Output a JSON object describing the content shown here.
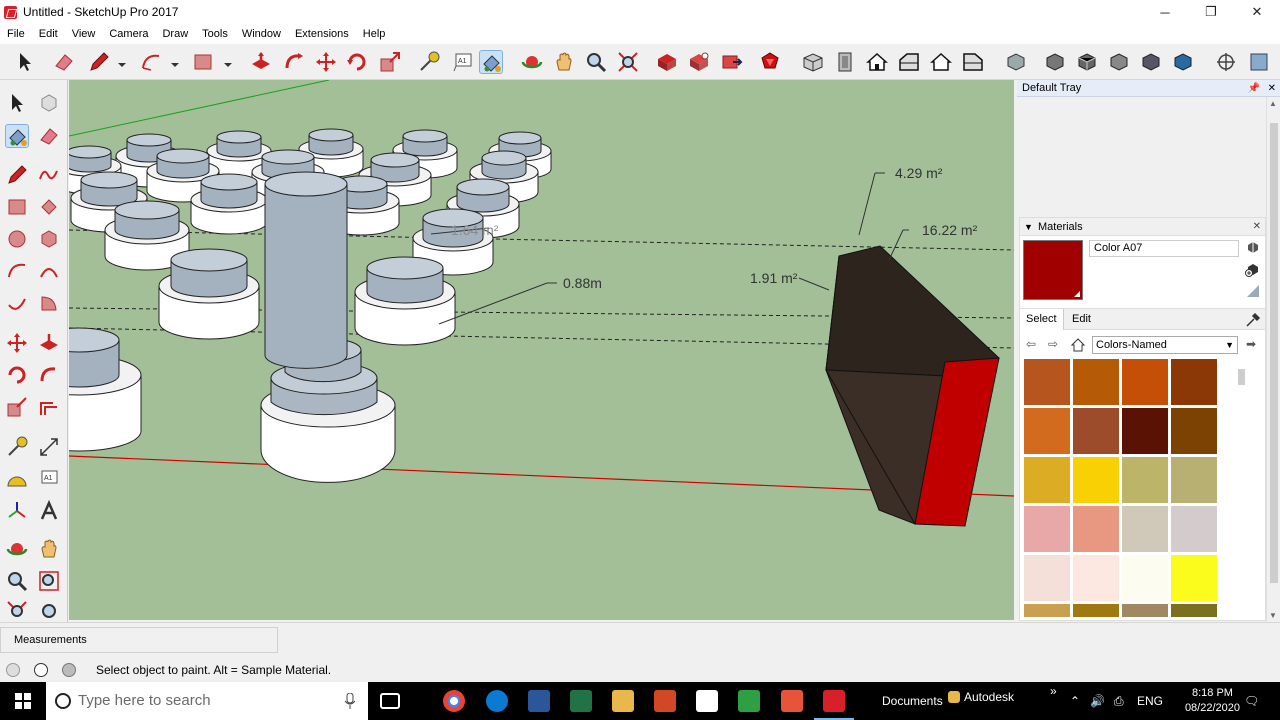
{
  "window": {
    "title": "Untitled - SketchUp Pro 2017",
    "controls": {
      "minimize": "─",
      "maximize": "❐",
      "close": "✕"
    }
  },
  "menu": [
    "File",
    "Edit",
    "View",
    "Camera",
    "Draw",
    "Tools",
    "Window",
    "Extensions",
    "Help"
  ],
  "viewport": {
    "dimensions": {
      "area_small": "4.29 m²",
      "area_large": "16.22 m²",
      "area_side": "1.91 m²",
      "area_hidden": "1.64 m²",
      "length": "0.88m"
    },
    "colors": {
      "ground": "#a3bf98",
      "red_axis": "#cc0000",
      "green_axis": "#00aa00",
      "box_front": "#c00000",
      "box_side": "#2d241e"
    }
  },
  "tray": {
    "title": "Default Tray",
    "materials": {
      "header": "Materials",
      "current_name": "Color A07",
      "current_color": "#a00000",
      "tabs": [
        "Select",
        "Edit"
      ],
      "library": "Colors-Named",
      "swatches": [
        "#b6561e",
        "#b55a06",
        "#c64f08",
        "#8c3806",
        "#d36b1e",
        "#9c4c2a",
        "#5a1204",
        "#7c4204",
        "#dcac24",
        "#f8d004",
        "#bcb468",
        "#b8b072",
        "#e8a8a8",
        "#e89880",
        "#d0c8b8",
        "#d4cccc",
        "#f4e0d8",
        "#fce8e0",
        "#fcfcf0",
        "#fcfc1c",
        "#c8a050",
        "#a07810",
        "#a08860",
        "#7c7020"
      ]
    }
  },
  "measurements": {
    "label": "Measurements"
  },
  "status": {
    "hint": "Select object to paint. Alt = Sample Material."
  },
  "taskbar": {
    "search_placeholder": "Type here to search",
    "documents": "Documents",
    "autodesk": "Autodesk",
    "lang": "ENG",
    "time": "8:18 PM",
    "date": "08/22/2020"
  }
}
